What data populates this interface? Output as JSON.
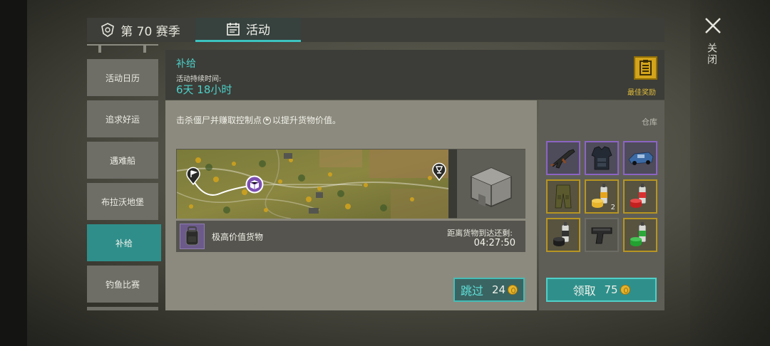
{
  "tabs": {
    "season": "第 70 赛季",
    "events": "活动"
  },
  "close_label": "关闭",
  "sidebar": {
    "items": [
      {
        "label": "活动日历",
        "active": false
      },
      {
        "label": "追求好运",
        "active": false
      },
      {
        "label": "遇难船",
        "active": false
      },
      {
        "label": "布拉沃地堡",
        "active": false
      },
      {
        "label": "补给",
        "active": true
      },
      {
        "label": "钓鱼比赛",
        "active": false
      }
    ]
  },
  "header": {
    "title": "补给",
    "duration_label": "活动持续时间:",
    "duration_value": "6天 18小时",
    "best_reward_label": "最佳奖励"
  },
  "main": {
    "description_before": "击杀僵尸并赚取控制点",
    "description_after": "以提升货物价值。",
    "cargo_name": "极高价值货物",
    "arrival_label": "距离货物到达还剩:",
    "arrival_time": "04:27:50",
    "skip_label": "跳过",
    "skip_cost": "24"
  },
  "warehouse": {
    "label": "仓库",
    "slots": [
      {
        "icon": "rifle-icon",
        "rarity": "purple",
        "count": ""
      },
      {
        "icon": "armor-vest-icon",
        "rarity": "purple",
        "count": ""
      },
      {
        "icon": "vehicle-icon",
        "rarity": "purple",
        "count": ""
      },
      {
        "icon": "pants-icon",
        "rarity": "gold",
        "count": ""
      },
      {
        "icon": "spray-yellow-icon",
        "rarity": "gold",
        "count": "2"
      },
      {
        "icon": "spray-red-icon",
        "rarity": "gold",
        "count": ""
      },
      {
        "icon": "spray-black-icon",
        "rarity": "gold",
        "count": ""
      },
      {
        "icon": "pistol-icon",
        "rarity": "gray",
        "count": ""
      },
      {
        "icon": "spray-green-icon",
        "rarity": "gold",
        "count": ""
      }
    ],
    "claim_label": "领取",
    "claim_cost": "75"
  },
  "colors": {
    "accent_teal": "#4ccfc8",
    "gold": "#d3a41b",
    "epic_purple": "#8b64c4"
  }
}
